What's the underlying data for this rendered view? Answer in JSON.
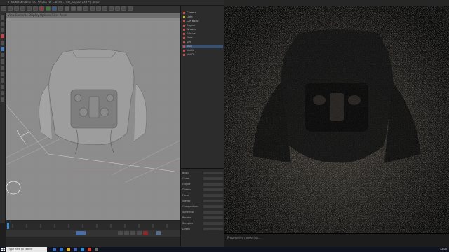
{
  "app": {
    "title": "CINEMA 4D R19.024 Studio (RC - R19) - [car_engine.c4d *] - Main",
    "viewport_label": "View  Cameras  Display  Options  Filter  Panel",
    "toolbar_icons": [
      "undo-icon",
      "redo-icon",
      "select-icon",
      "move-icon",
      "scale-icon",
      "rotate-icon",
      "axis-x-icon",
      "axis-y-icon",
      "axis-z-icon",
      "coord-icon",
      "render-view-icon",
      "render-pv-icon",
      "render-settings-icon",
      "cube-icon",
      "spline-icon",
      "nurbs-icon",
      "array-icon",
      "deformer-icon",
      "scene-icon",
      "camera-icon",
      "light-icon"
    ]
  },
  "object_manager": {
    "items": [
      {
        "label": "Camera"
      },
      {
        "label": "Light"
      },
      {
        "label": "Car_Body"
      },
      {
        "label": "Engine"
      },
      {
        "label": "Wheels"
      },
      {
        "label": "Exhaust"
      },
      {
        "label": "Floor"
      },
      {
        "label": "Sky"
      },
      {
        "label": "Null"
      },
      {
        "label": "Null.1"
      },
      {
        "label": "Null.2"
      }
    ]
  },
  "attributes": {
    "rows": [
      {
        "key": "Basic"
      },
      {
        "key": "Coord."
      },
      {
        "key": "Object"
      },
      {
        "key": "Details"
      },
      {
        "key": "Focus"
      },
      {
        "key": "Stereo"
      },
      {
        "key": "Composition"
      },
      {
        "key": "Spherical"
      },
      {
        "key": "Render"
      },
      {
        "key": "Samples"
      },
      {
        "key": "Depth"
      }
    ]
  },
  "render_view": {
    "status": "Progressive rendering..."
  },
  "taskbar": {
    "search_placeholder": "Type here to search",
    "clock": "12:00"
  }
}
